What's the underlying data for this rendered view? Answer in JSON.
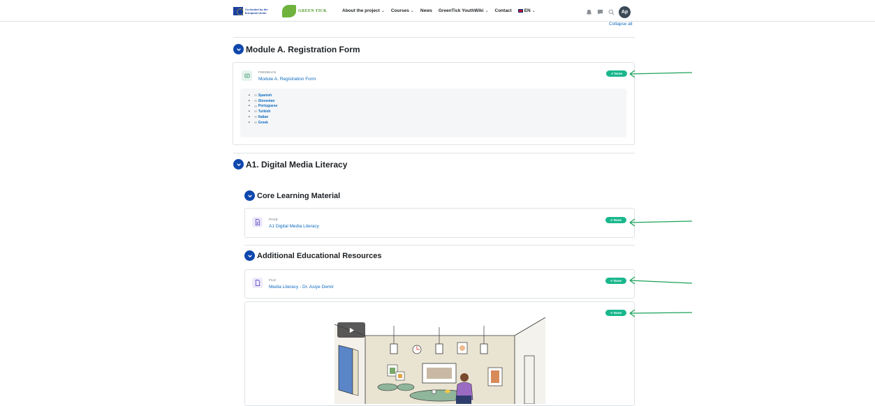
{
  "nav": {
    "eu_logo_text": "Co-funded by the European Union",
    "gt_logo_text": "GREEN TICK",
    "items": [
      {
        "label": "About the project",
        "dropdown": true
      },
      {
        "label": "Courses",
        "dropdown": true
      },
      {
        "label": "News",
        "dropdown": false
      },
      {
        "label": "GreenTick YouthWiki",
        "dropdown": true
      },
      {
        "label": "Contact",
        "dropdown": false
      }
    ],
    "language": "EN",
    "avatar_initials": "Ap"
  },
  "collapse_all": "Collapse all",
  "sections": {
    "module_a": {
      "title": "Module A. Registration Form",
      "activity": {
        "type": "FEEDBACK",
        "name": "Module A. Registration Form",
        "status": "Done"
      },
      "languages": [
        "Spanish",
        "Slovenian",
        "Portuguese",
        "Turkish",
        "Italian",
        "Greek"
      ]
    },
    "a1": {
      "title": "A1. Digital Media Literacy",
      "core": {
        "title": "Core Learning Material",
        "activity": {
          "type": "PAGE",
          "name": "A1 Digital Media Literacy",
          "status": "Done"
        }
      },
      "additional": {
        "title": "Additional Educational Resources",
        "file": {
          "type": "FILE",
          "name": "Media Literacy - Dr. Asiye Demir",
          "status": "Done"
        },
        "video_status": "Done"
      }
    }
  },
  "colors": {
    "accent": "#0f47ad",
    "link": "#0f6cbf",
    "done_badge": "#1ab78c",
    "annotation_arrow": "#1aa35a"
  }
}
